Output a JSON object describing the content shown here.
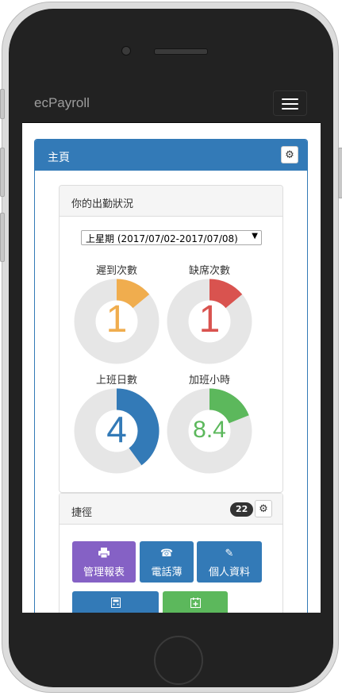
{
  "app": {
    "brand": "ecPayroll"
  },
  "main_panel": {
    "title": "主頁"
  },
  "attendance": {
    "title": "你的出勤狀況",
    "period_selected": "上星期 (2017/07/02-2017/07/08)",
    "gauges": [
      {
        "label": "遲到次數",
        "value": "1",
        "fill": 0.14,
        "color": "#f0ad4e"
      },
      {
        "label": "缺席次數",
        "value": "1",
        "fill": 0.14,
        "color": "#d9534f"
      },
      {
        "label": "上班日數",
        "value": "4",
        "fill": 0.4,
        "color": "#337ab7"
      },
      {
        "label": "加班小時",
        "value": "8.4",
        "fill": 0.19,
        "color": "#5cb85c"
      }
    ]
  },
  "shortcuts": {
    "title": "捷徑",
    "count": "22",
    "tiles": [
      {
        "label": "管理報表",
        "icon": "print-icon",
        "color": "purple"
      },
      {
        "label": "電話薄",
        "icon": "phone-icon",
        "color": "blue"
      },
      {
        "label": "個人資料",
        "icon": "pencil-icon",
        "color": "blue"
      },
      {
        "label": "",
        "icon": "calculator-icon",
        "color": "blue"
      },
      {
        "label": "",
        "icon": "calendar-plus-icon",
        "color": "green"
      }
    ]
  },
  "colors": {
    "primary": "#337ab7",
    "navbar": "#222222",
    "track": "#e6e6e6"
  }
}
